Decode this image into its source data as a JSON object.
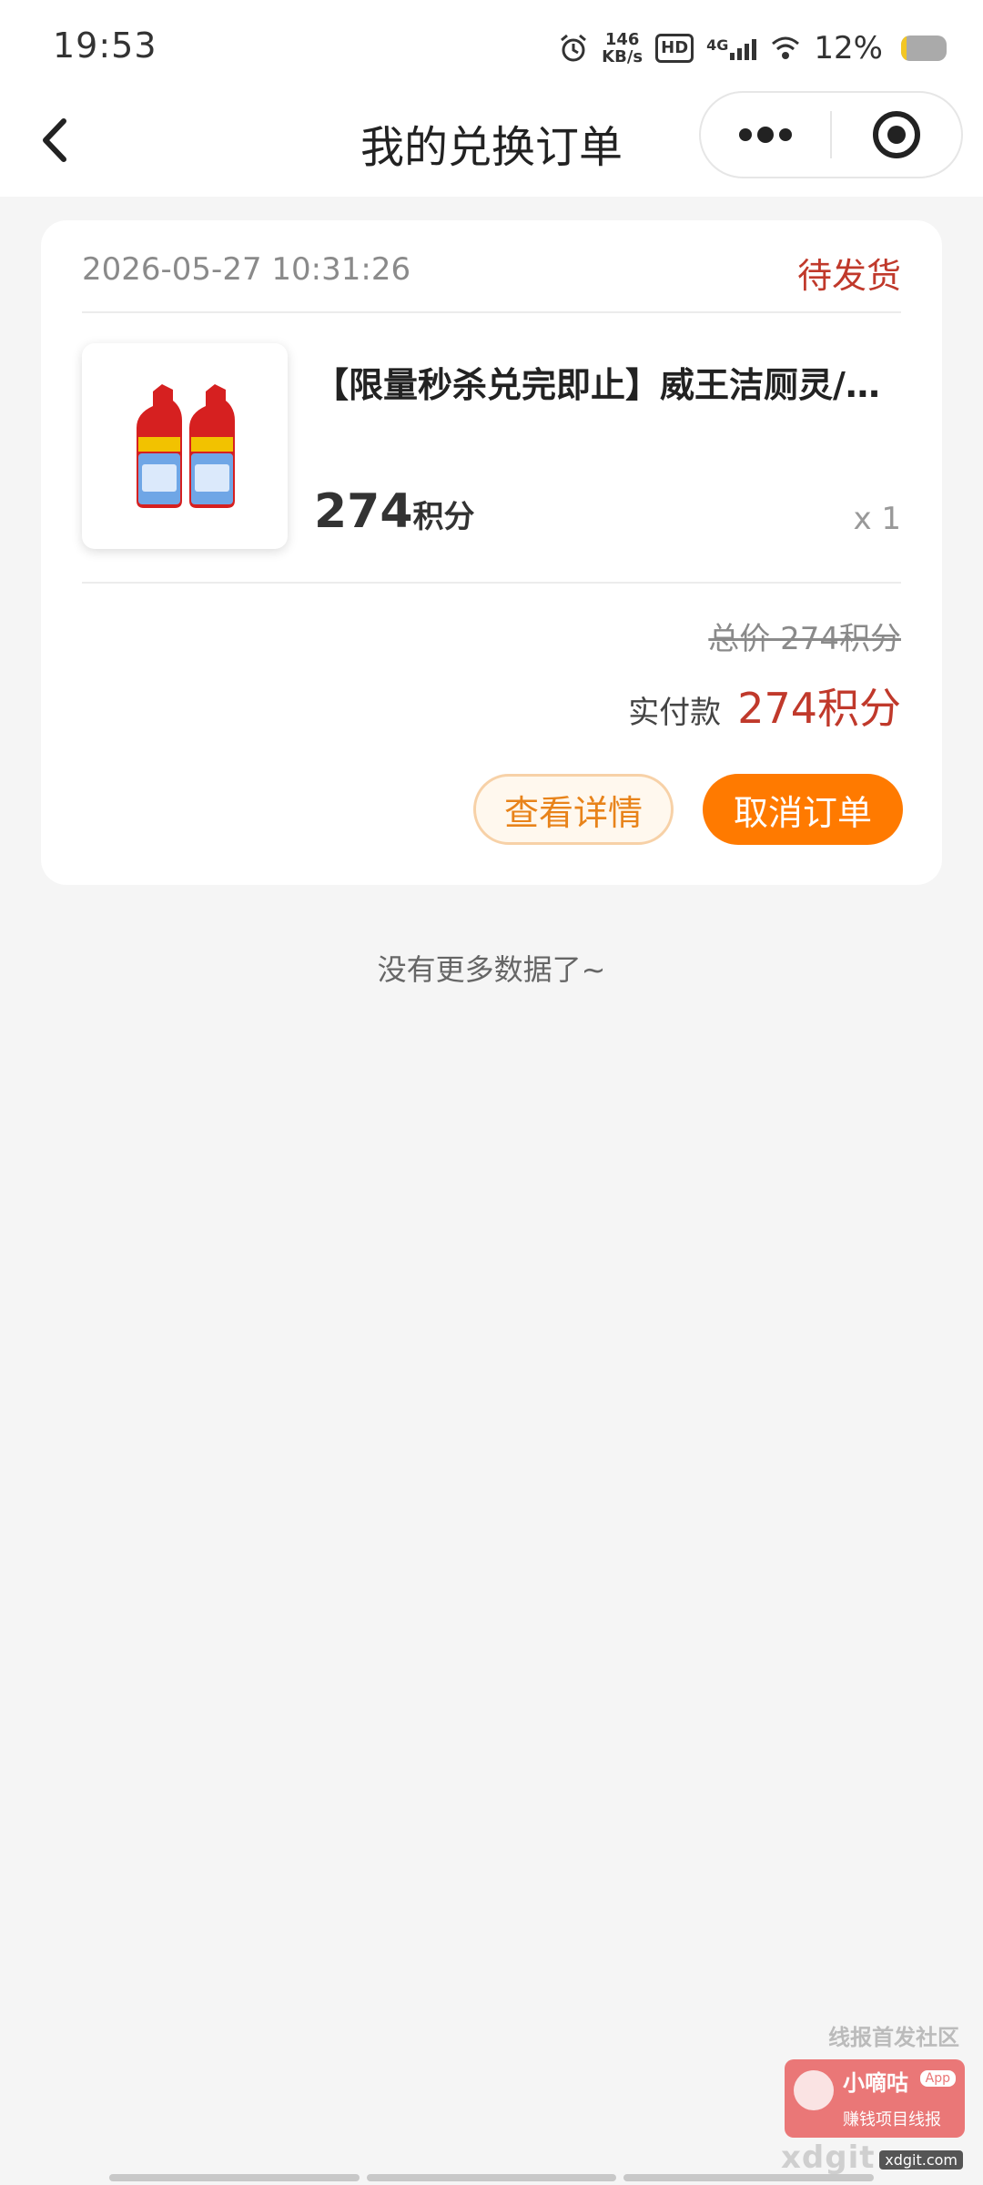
{
  "status_bar": {
    "time": "19:53",
    "net_speed_value": "146",
    "net_speed_unit": "KB/s",
    "hd_label": "HD",
    "network_type": "4G",
    "battery_percent": "12%",
    "battery_level": 0.12,
    "icons": [
      "alarm-icon",
      "hd-icon",
      "signal-icon",
      "wifi-icon",
      "battery-icon"
    ]
  },
  "nav": {
    "title": "我的兑换订单",
    "back_icon": "chevron-left-icon",
    "more_icon": "more-dots-icon",
    "close_icon": "target-circle-icon"
  },
  "order": {
    "date": "2026-05-27 10:31:26",
    "status": "待发货",
    "product": {
      "title": "【限量秒杀兑完即止】威王洁厕灵/家用卫生间马桶清洁剂",
      "price_value": "274",
      "price_unit": "积分",
      "quantity": "x 1",
      "image": "toilet-cleaner-bottles-image"
    },
    "total": "总价 274积分",
    "paid_label": "实付款",
    "paid_value": "274积分",
    "detail_button": "查看详情",
    "cancel_button": "取消订单"
  },
  "footer_text": "没有更多数据了~",
  "watermark": {
    "top": "线报首发社区",
    "name": "小嘀咕",
    "app": "App",
    "sub": "赚钱项目线报",
    "site": "xdgit",
    "site_small": "xdgit.com"
  },
  "colors": {
    "accent_orange": "#ff7a00",
    "status_red": "#c0392b",
    "background": "#f5f5f5"
  }
}
